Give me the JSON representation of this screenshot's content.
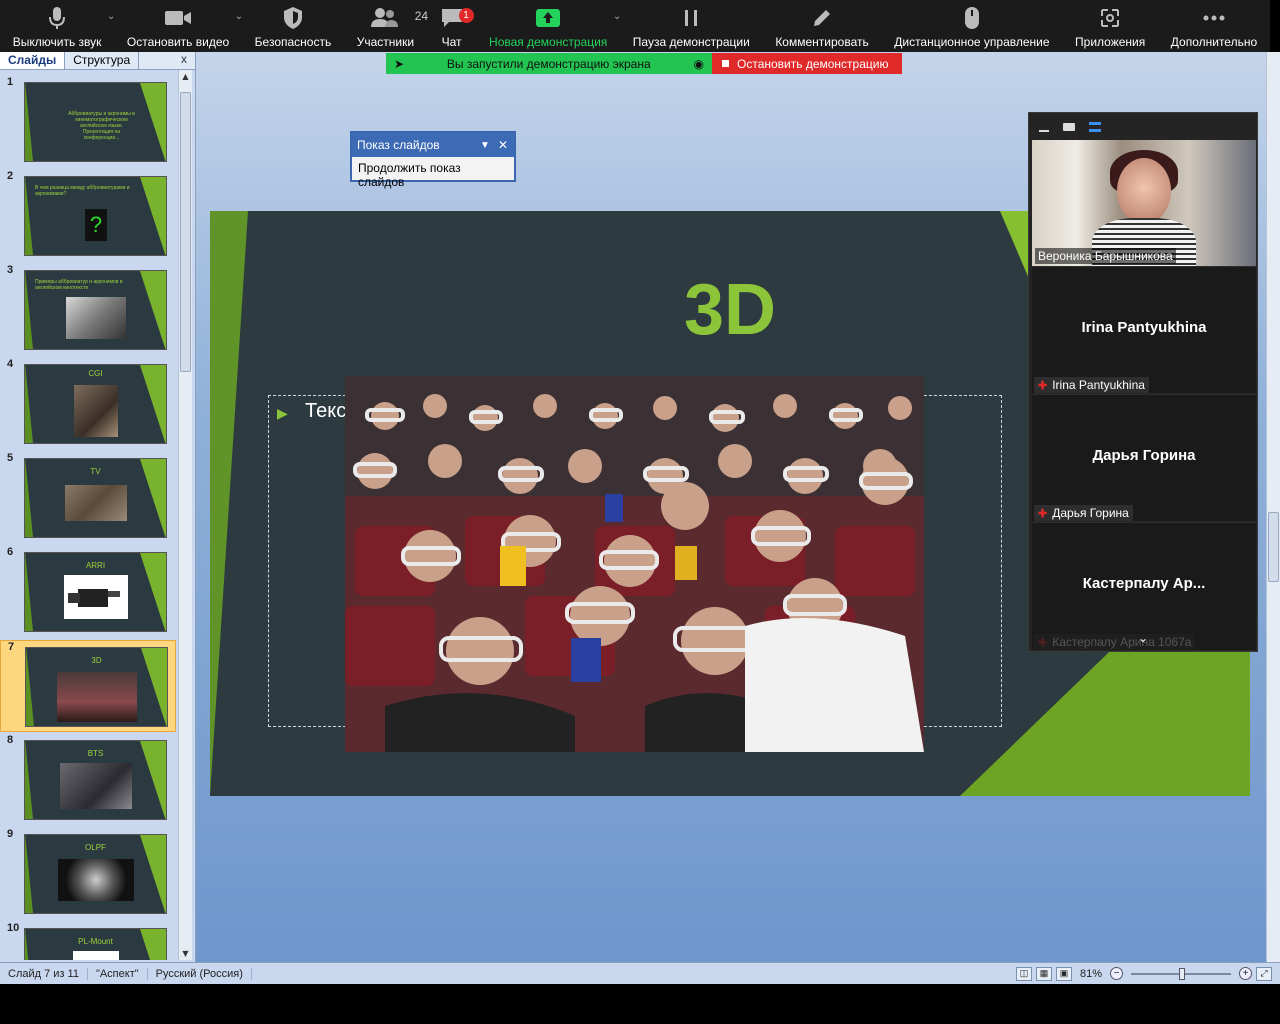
{
  "zoom_toolbar": {
    "mute": "Выключить звук",
    "stop_video": "Остановить видео",
    "security": "Безопасность",
    "participants": "Участники",
    "participants_count": "24",
    "chat": "Чат",
    "chat_badge": "1",
    "new_share": "Новая демонстрация",
    "pause_share": "Пауза демонстрации",
    "annotate": "Комментировать",
    "remote_control": "Дистанционное управление",
    "apps": "Приложения",
    "more": "Дополнительно"
  },
  "share_banner": {
    "message": "Вы запустили демонстрацию экрана",
    "stop": "Остановить демонстрацию"
  },
  "left_pane": {
    "tab_slides": "Слайды",
    "tab_outline": "Структура",
    "close": "x",
    "thumbnails": [
      {
        "num": "1",
        "title": "",
        "text": "Аббревиатуры и акронимы в кинематографическом английском языке. Презентация на конференции..."
      },
      {
        "num": "2",
        "title": "",
        "text": "В чем разница между аббревиатурами и акронимами?"
      },
      {
        "num": "3",
        "title": "",
        "text": "Примеры аббревиатур и акронимов в английском кинотексте"
      },
      {
        "num": "4",
        "title": "CGI",
        "text": ""
      },
      {
        "num": "5",
        "title": "TV",
        "text": ""
      },
      {
        "num": "6",
        "title": "ARRI",
        "text": ""
      },
      {
        "num": "7",
        "title": "3D",
        "text": ""
      },
      {
        "num": "8",
        "title": "BTS",
        "text": ""
      },
      {
        "num": "9",
        "title": "OLPF",
        "text": ""
      },
      {
        "num": "10",
        "title": "PL-Mount",
        "text": ""
      }
    ]
  },
  "slide": {
    "title": "3D",
    "placeholder_text": "Текс"
  },
  "slideshow_popup": {
    "title": "Показ слайдов",
    "continue": "Продолжить показ слайдов"
  },
  "gallery": {
    "video_name": "Вероника Барышникова",
    "tiles": [
      {
        "big": "Irina Pantyukhina",
        "small": "Irina Pantyukhina"
      },
      {
        "big": "Дарья Горина",
        "small": "Дарья Горина"
      },
      {
        "big": "Кастерпалу  Ар...",
        "small": "Кастерпалу Арина 1067а"
      }
    ]
  },
  "status_bar": {
    "slide_info": "Слайд 7 из 11",
    "theme": "\"Аспект\"",
    "language": "Русский (Россия)",
    "zoom": "81%"
  }
}
